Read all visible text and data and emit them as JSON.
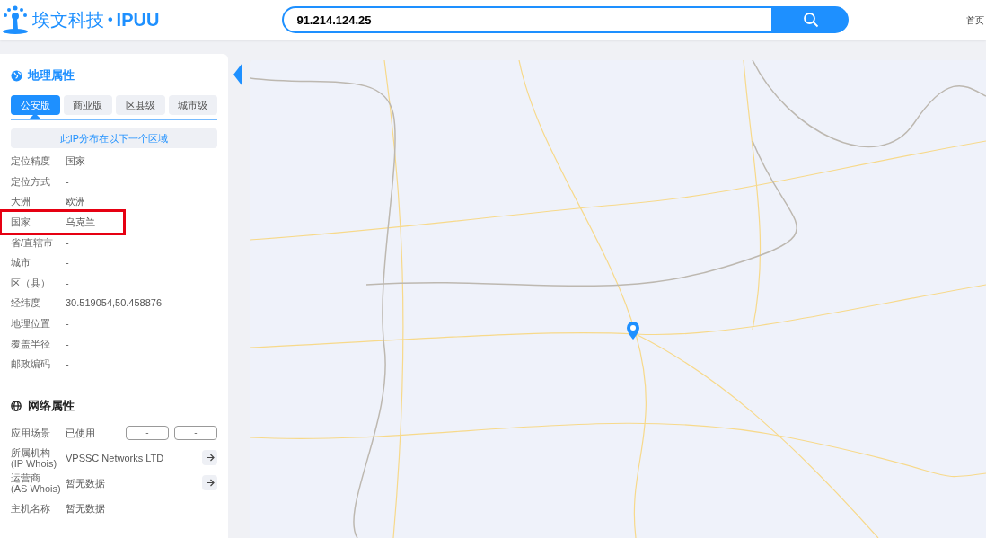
{
  "header": {
    "brand": "埃文科技",
    "separator": "•",
    "product": "IPUU",
    "search": {
      "value": "91.214.124.25"
    },
    "nav": [
      "首页"
    ]
  },
  "geo": {
    "title": "地理属性",
    "tabs": [
      {
        "label": "公安版",
        "selected": true
      },
      {
        "label": "商业版",
        "selected": false
      },
      {
        "label": "区县级",
        "selected": false
      },
      {
        "label": "城市级",
        "selected": false
      }
    ],
    "region_note": "此IP分布在以下一个区域",
    "rows": [
      {
        "label": "定位精度",
        "value": "国家",
        "highlighted": false
      },
      {
        "label": "定位方式",
        "value": "-",
        "highlighted": false
      },
      {
        "label": "大洲",
        "value": "欧洲",
        "highlighted": false
      },
      {
        "label": "国家",
        "value": "乌克兰",
        "highlighted": true
      },
      {
        "label": "省/直辖市",
        "value": "-",
        "highlighted": false
      },
      {
        "label": "城市",
        "value": "-",
        "highlighted": false
      },
      {
        "label": "区（县）",
        "value": "-",
        "highlighted": false
      },
      {
        "label": "经纬度",
        "value": "30.519054,50.458876",
        "highlighted": false
      },
      {
        "label": "地理位置",
        "value": "-",
        "highlighted": false
      },
      {
        "label": "覆盖半径",
        "value": "-",
        "highlighted": false
      },
      {
        "label": "邮政编码",
        "value": "-",
        "highlighted": false
      }
    ]
  },
  "network": {
    "title": "网络属性",
    "rows": [
      {
        "kind": "tags",
        "label": "应用场景",
        "value": "已使用",
        "tags": [
          "-",
          "-"
        ]
      },
      {
        "kind": "link",
        "label": "所属机构",
        "label_note": "(IP Whois)",
        "value": "VPSSC Networks LTD"
      },
      {
        "kind": "link",
        "label": "运营商",
        "label_note": "(AS Whois)",
        "value": "暂无数据"
      },
      {
        "kind": "plain",
        "label": "主机名称",
        "value": "暂无数据"
      }
    ]
  }
}
